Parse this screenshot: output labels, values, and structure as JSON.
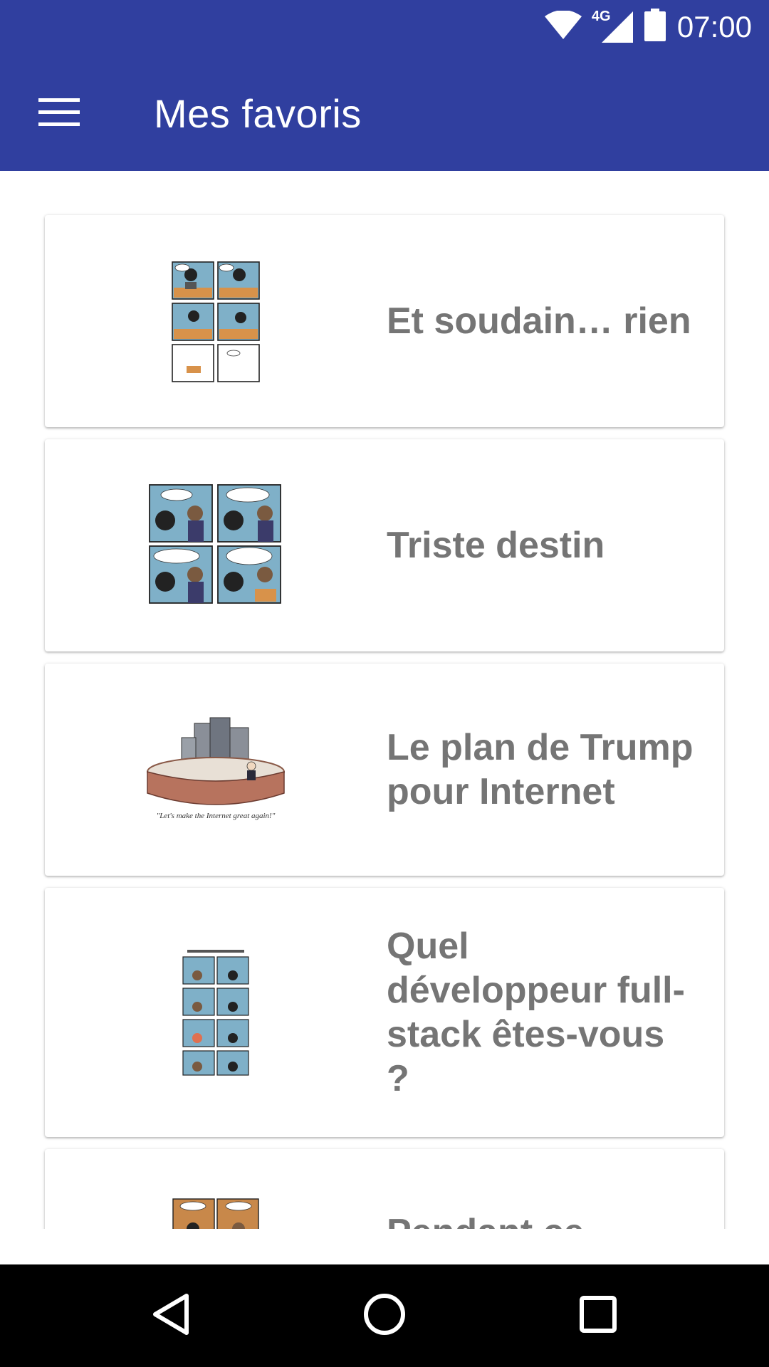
{
  "status_bar": {
    "time": "07:00",
    "network": "4G",
    "icons": [
      "wifi-icon",
      "cell-signal-icon",
      "battery-icon"
    ]
  },
  "app_bar": {
    "title": "Mes favoris",
    "menu_icon": "menu-icon"
  },
  "favorites": [
    {
      "title": "Et soudain… rien",
      "thumbnail": "comic-six-panel-desk"
    },
    {
      "title": "Triste destin",
      "thumbnail": "comic-four-panel-chat"
    },
    {
      "title": "Le plan de Trump pour Internet",
      "thumbnail": "cartoon-wall-servers",
      "caption": "\"Let's make the Internet great again!\""
    },
    {
      "title": "Quel développeur full-stack êtes-vous ?",
      "thumbnail": "comic-quiz-grid"
    },
    {
      "title": "Pendant ce temps",
      "thumbnail": "comic-brown-panels"
    }
  ],
  "nav_bar": {
    "back_icon": "back-triangle-icon",
    "home_icon": "home-circle-icon",
    "recents_icon": "recents-square-icon"
  },
  "colors": {
    "primary": "#303F9F",
    "title_text": "#757575"
  }
}
